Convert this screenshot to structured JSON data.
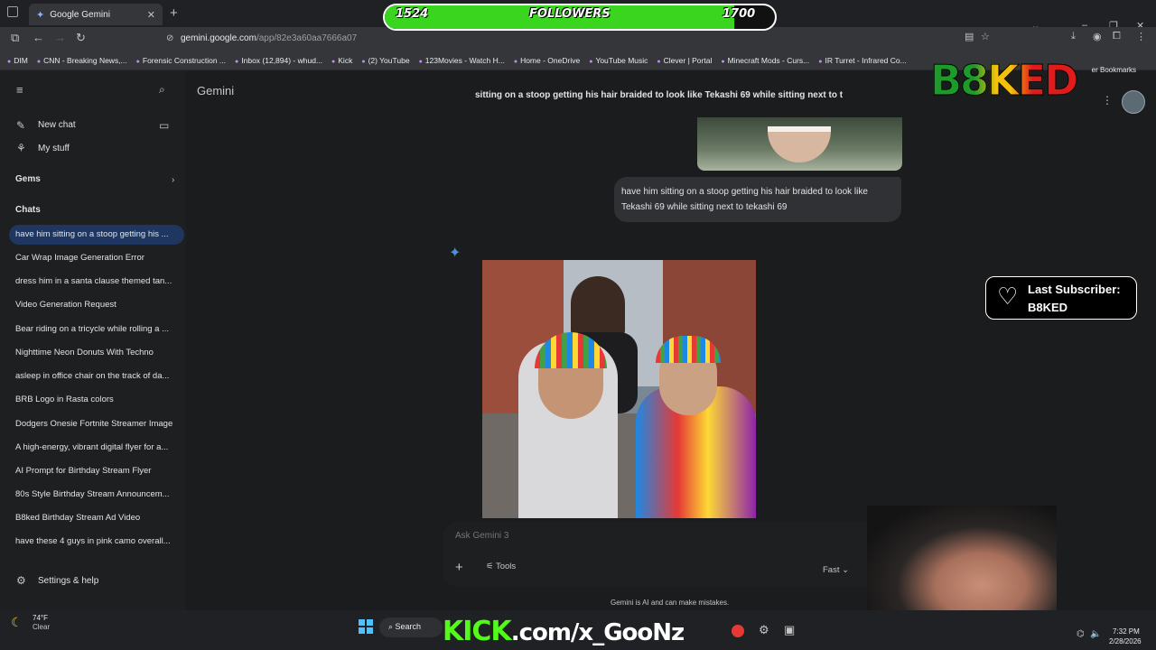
{
  "browser": {
    "tab_title": "Google Gemini",
    "url_host": "gemini.google.com",
    "url_path": "/app/82e3a60aa7666a07",
    "bookmarks": [
      "DIM",
      "CNN - Breaking News,...",
      "Forensic Construction ...",
      "Inbox (12,894) - whud...",
      "Kick",
      "(2) YouTube",
      "123Movies - Watch H...",
      "Home - OneDrive",
      "YouTube Music",
      "Clever | Portal",
      "Minecraft Mods - Curs...",
      "IR Turret - Infrared Co..."
    ],
    "bookmarks_right": "er Bookmarks"
  },
  "sidebar": {
    "new_chat": "New chat",
    "my_stuff": "My stuff",
    "gems": "Gems",
    "chats_heading": "Chats",
    "chats": [
      "have him sitting on a stoop getting his ...",
      "Car Wrap Image Generation Error",
      "dress him in a santa clause themed tan...",
      "Video Generation Request",
      "Bear riding on a tricycle while rolling a ...",
      "Nighttime Neon Donuts With Techno",
      "asleep in office chair on the track of da...",
      "BRB Logo in Rasta colors",
      "Dodgers Onesie Fortnite Streamer Image",
      "A high-energy, vibrant digital flyer for a...",
      "AI Prompt for Birthday Stream Flyer",
      "80s Style Birthday Stream Announcem...",
      "B8ked Birthday Stream Ad Video",
      "have these 4 guys in pink camo overall..."
    ],
    "settings": "Settings & help"
  },
  "main": {
    "title": "Gemini",
    "top_prompt": "sitting on a stoop getting his hair braided to look like Tekashi 69 while sitting next to t",
    "user_message": "have him sitting on a stoop getting his hair braided to look like Tekashi 69 while sitting next to tekashi 69",
    "input_placeholder": "Ask Gemini 3",
    "tools_label": "Tools",
    "mode_label": "Fast",
    "disclaimer": "Gemini is AI and can make mistakes."
  },
  "overlay": {
    "followers_current": "1524",
    "followers_label": "FOLLOWERS",
    "followers_goal": "1700",
    "followers_progress": 0.896,
    "channel_logo": "B8KED",
    "last_sub_label": "Last Subscriber:",
    "last_sub_name": "B8KED",
    "kick_url_main": "KICK",
    "kick_url_rest": ".com/x_GooNz"
  },
  "taskbar": {
    "weather_temp": "74°F",
    "weather_desc": "Clear",
    "search": "Search",
    "time": "7:32 PM",
    "date": "2/28/2026"
  },
  "colors": {
    "accent_blue": "#1f3760",
    "kick_green": "#53fc18",
    "follower_fill": "#39d51f"
  }
}
